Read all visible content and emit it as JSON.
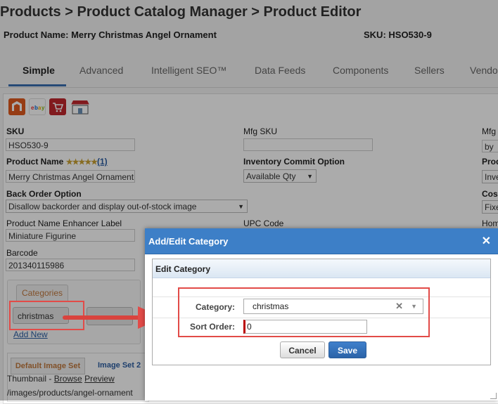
{
  "header": {
    "breadcrumb": "Products > Product Catalog Manager > Product Editor",
    "product_name_label": "Product Name: Merry Christmas Angel Ornament",
    "sku_label": "SKU: HSO530-9"
  },
  "tabs": [
    {
      "label": "Simple",
      "active": true
    },
    {
      "label": "Advanced",
      "active": false
    },
    {
      "label": "Intelligent SEO™",
      "active": false
    },
    {
      "label": "Data Feeds",
      "active": false
    },
    {
      "label": "Components",
      "active": false
    },
    {
      "label": "Sellers",
      "active": false
    },
    {
      "label": "Vendo",
      "active": false
    }
  ],
  "channel_icons": [
    "magento-icon",
    "ebay-icon",
    "cart-icon",
    "storefront-icon"
  ],
  "form": {
    "sku": {
      "label": "SKU",
      "value": "HSO530-9"
    },
    "mfg_sku": {
      "label": "Mfg SKU",
      "value": ""
    },
    "mfg_right": {
      "label": "Mfg",
      "value": "by"
    },
    "product_name": {
      "label": "Product Name",
      "stars": "★★★★★",
      "reviews": "(1)",
      "value": "Merry Christmas Angel Ornament"
    },
    "inventory_commit": {
      "label": "Inventory Commit Option",
      "value": "Available Qty"
    },
    "prod_right": {
      "label": "Prod",
      "value": "Inve"
    },
    "back_order": {
      "label": "Back Order Option",
      "value": "Disallow backorder and display out-of-stock image"
    },
    "cost_right": {
      "label": "Cos",
      "value": "Fixe"
    },
    "name_enhancer": {
      "label": "Product Name Enhancer Label",
      "value": "Miniature Figurine"
    },
    "upc": {
      "label": "UPC Code"
    },
    "hom_right": {
      "label": "Hom"
    },
    "barcode": {
      "label": "Barcode",
      "value": "201340115986"
    }
  },
  "categories": {
    "tab_label": "Categories",
    "chip": "christmas",
    "add_new": "Add New"
  },
  "image_sets": {
    "tab1": "Default Image Set",
    "tab2": "Image Set 2",
    "thumbnail_prefix": "Thumbnail - ",
    "browse": "Browse",
    "preview": "Preview",
    "path": "/images/products/angel-ornament"
  },
  "dialog": {
    "title": "Add/Edit Category",
    "section": "Edit Category",
    "category_label": "Category:",
    "category_value": "christmas",
    "sort_label": "Sort Order:",
    "sort_value": "0",
    "cancel": "Cancel",
    "save": "Save"
  },
  "colors": {
    "accent_blue": "#3d7fc7",
    "highlight_red": "#e24b48",
    "tab_orange": "#c0793e"
  }
}
